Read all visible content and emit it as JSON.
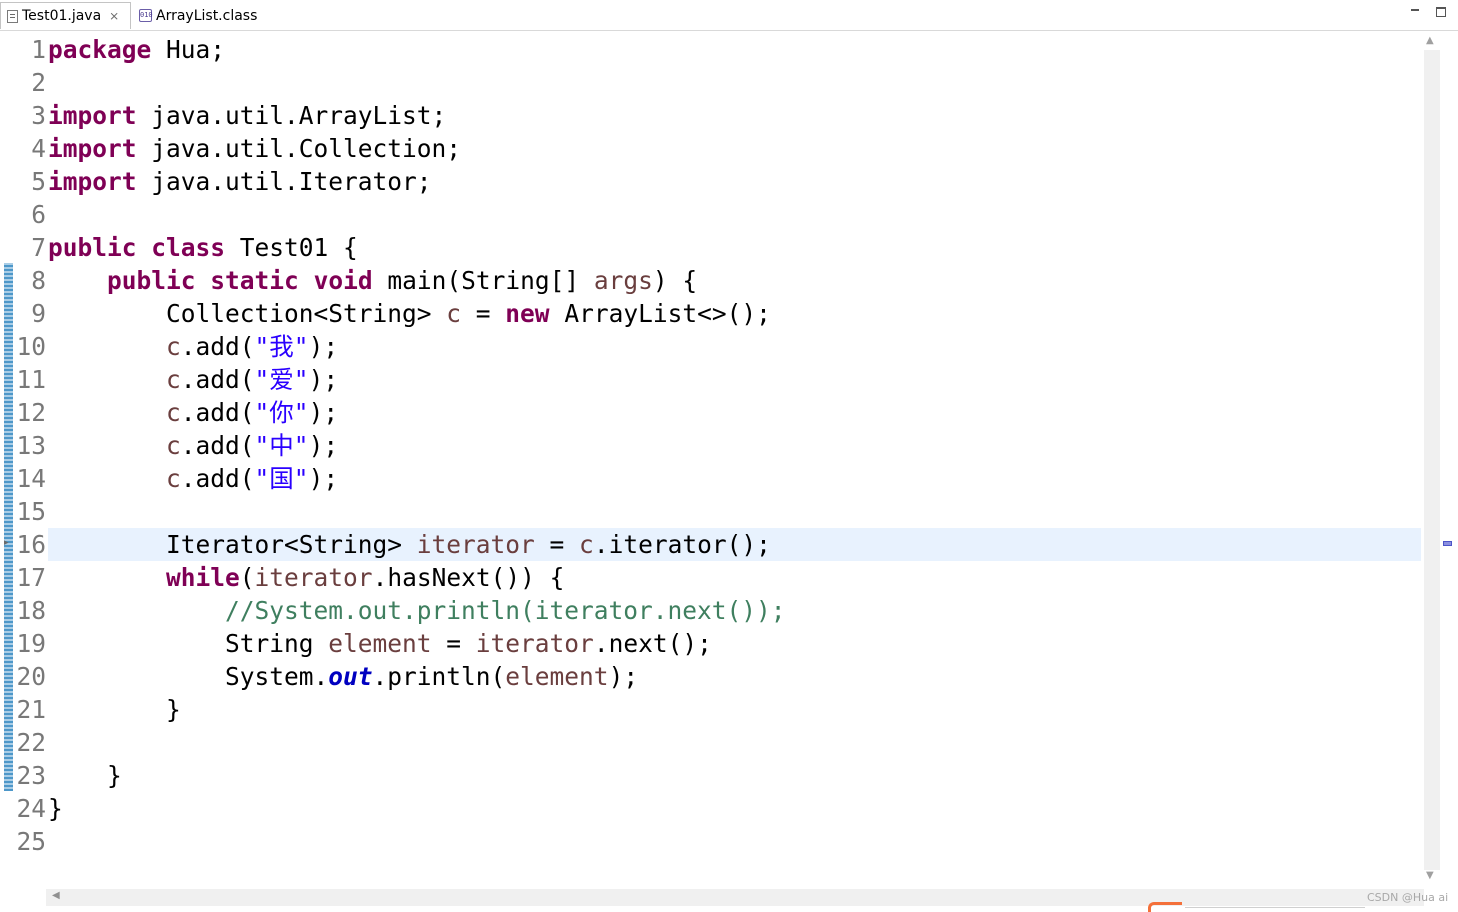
{
  "tabs": [
    {
      "label": "Test01.java",
      "icon": "java-file-icon",
      "active": true,
      "close": "⨯"
    },
    {
      "label": "ArrayList.class",
      "icon": "class-file-icon",
      "active": false
    }
  ],
  "class_icon_text": "010",
  "watermark": "CSDN @Hua ai",
  "colors": {
    "keyword": "#7f0055",
    "string": "#2a00ff",
    "comment": "#3f7f5f",
    "local_variable": "#6a3e3e",
    "static_field": "#0000c0",
    "current_line": "#e8f2fe",
    "line_number": "#787878"
  },
  "code_lines": [
    {
      "n": "1",
      "tokens": [
        [
          "kw",
          "package"
        ],
        [
          "p",
          " Hua;"
        ]
      ]
    },
    {
      "n": "2",
      "tokens": []
    },
    {
      "n": "3",
      "tokens": [
        [
          "kw",
          "import"
        ],
        [
          "p",
          " java.util.ArrayList;"
        ]
      ]
    },
    {
      "n": "4",
      "tokens": [
        [
          "kw",
          "import"
        ],
        [
          "p",
          " java.util.Collection;"
        ]
      ]
    },
    {
      "n": "5",
      "tokens": [
        [
          "kw",
          "import"
        ],
        [
          "p",
          " java.util.Iterator;"
        ]
      ]
    },
    {
      "n": "6",
      "tokens": []
    },
    {
      "n": "7",
      "tokens": [
        [
          "kw",
          "public"
        ],
        [
          "p",
          " "
        ],
        [
          "kw",
          "class"
        ],
        [
          "p",
          " Test01 {"
        ]
      ]
    },
    {
      "n": "8",
      "tokens": [
        [
          "p",
          "    "
        ],
        [
          "kw",
          "public"
        ],
        [
          "p",
          " "
        ],
        [
          "kw",
          "static"
        ],
        [
          "p",
          " "
        ],
        [
          "kw",
          "void"
        ],
        [
          "p",
          " main(String[] "
        ],
        [
          "var",
          "args"
        ],
        [
          "p",
          ") {"
        ]
      ]
    },
    {
      "n": "9",
      "tokens": [
        [
          "p",
          "        Collection<String> "
        ],
        [
          "var",
          "c"
        ],
        [
          "p",
          " = "
        ],
        [
          "kw",
          "new"
        ],
        [
          "p",
          " ArrayList<>();"
        ]
      ]
    },
    {
      "n": "10",
      "tokens": [
        [
          "p",
          "        "
        ],
        [
          "var",
          "c"
        ],
        [
          "p",
          ".add("
        ],
        [
          "str",
          "\"我\""
        ],
        [
          "p",
          ");"
        ]
      ]
    },
    {
      "n": "11",
      "tokens": [
        [
          "p",
          "        "
        ],
        [
          "var",
          "c"
        ],
        [
          "p",
          ".add("
        ],
        [
          "str",
          "\"爱\""
        ],
        [
          "p",
          ");"
        ]
      ]
    },
    {
      "n": "12",
      "tokens": [
        [
          "p",
          "        "
        ],
        [
          "var",
          "c"
        ],
        [
          "p",
          ".add("
        ],
        [
          "str",
          "\"你\""
        ],
        [
          "p",
          ");"
        ]
      ]
    },
    {
      "n": "13",
      "tokens": [
        [
          "p",
          "        "
        ],
        [
          "var",
          "c"
        ],
        [
          "p",
          ".add("
        ],
        [
          "str",
          "\"中\""
        ],
        [
          "p",
          ");"
        ]
      ]
    },
    {
      "n": "14",
      "tokens": [
        [
          "p",
          "        "
        ],
        [
          "var",
          "c"
        ],
        [
          "p",
          ".add("
        ],
        [
          "str",
          "\"国\""
        ],
        [
          "p",
          ");"
        ]
      ]
    },
    {
      "n": "15",
      "tokens": []
    },
    {
      "n": "16",
      "tokens": [
        [
          "p",
          "        Iterator<String> "
        ],
        [
          "var",
          "iterator"
        ],
        [
          "p",
          " = "
        ],
        [
          "var",
          "c"
        ],
        [
          "p",
          ".iterator();"
        ]
      ]
    },
    {
      "n": "17",
      "tokens": [
        [
          "p",
          "        "
        ],
        [
          "kw",
          "while"
        ],
        [
          "p",
          "("
        ],
        [
          "var",
          "iterator"
        ],
        [
          "p",
          ".hasNext()) {"
        ]
      ]
    },
    {
      "n": "18",
      "tokens": [
        [
          "p",
          "            "
        ],
        [
          "cm",
          "//System.out.println(iterator.next());"
        ]
      ]
    },
    {
      "n": "19",
      "tokens": [
        [
          "p",
          "            String "
        ],
        [
          "var",
          "element"
        ],
        [
          "p",
          " = "
        ],
        [
          "var",
          "iterator"
        ],
        [
          "p",
          ".next();"
        ]
      ]
    },
    {
      "n": "20",
      "tokens": [
        [
          "p",
          "            System."
        ],
        [
          "fld",
          "out"
        ],
        [
          "p",
          ".println("
        ],
        [
          "var",
          "element"
        ],
        [
          "p",
          ");"
        ]
      ]
    },
    {
      "n": "21",
      "tokens": [
        [
          "p",
          "        }"
        ]
      ]
    },
    {
      "n": "22",
      "tokens": []
    },
    {
      "n": "23",
      "tokens": [
        [
          "p",
          "    }"
        ]
      ]
    },
    {
      "n": "24",
      "tokens": [
        [
          "p",
          "}"
        ]
      ]
    },
    {
      "n": "25",
      "tokens": []
    }
  ],
  "current_line": "16"
}
